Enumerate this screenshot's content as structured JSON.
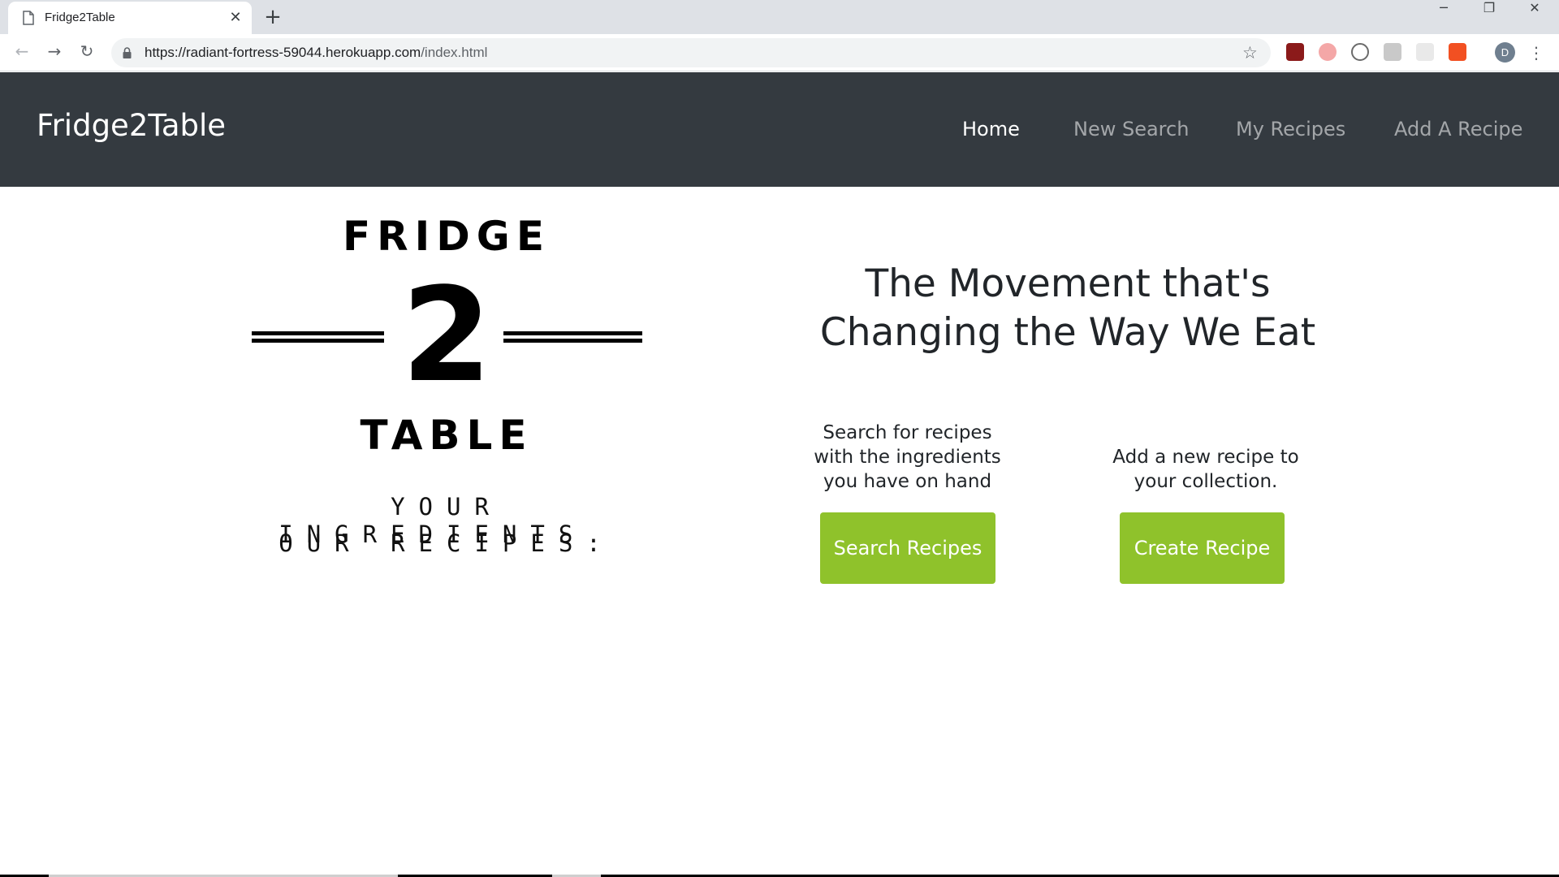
{
  "browser": {
    "tab_title": "Fridge2Table",
    "tab_close": "✕",
    "new_tab": "+",
    "url_host": "https://radiant-fortress-59044.herokuapp.com",
    "url_path": "/index.html",
    "profile_initial": "D",
    "window_controls": {
      "minimize": "─",
      "maximize": "❐",
      "close": "✕"
    }
  },
  "navbar": {
    "brand": "Fridge2Table",
    "links": [
      {
        "label": "Home",
        "active": true
      },
      {
        "label": "New Search",
        "active": false
      },
      {
        "label": "My Recipes",
        "active": false
      },
      {
        "label": "Add A Recipe",
        "active": false
      }
    ]
  },
  "logo": {
    "top_word": "FRIDGE",
    "numeral": "2",
    "bottom_word": "TABLE",
    "tagline_line1": "YOUR INGREDIENTS.",
    "tagline_line2": "OUR RECIPES."
  },
  "hero": {
    "headline_line1": "The Movement that's",
    "headline_line2": "Changing the Way We Eat"
  },
  "actions": [
    {
      "text_lines": [
        "Search for recipes",
        "with the ingredients",
        "you have on hand"
      ],
      "button": "Search Recipes"
    },
    {
      "text_lines": [
        "Add a new recipe to",
        "your collection."
      ],
      "button": "Create Recipe"
    }
  ],
  "colors": {
    "navbar_bg": "#343a40",
    "button_bg": "#8fc22b",
    "tab_strip": "#dee1e6"
  },
  "icons": [
    "page-icon",
    "back-icon",
    "forward-icon",
    "reload-icon",
    "lock-icon",
    "star-icon",
    "kebab-menu-icon"
  ]
}
